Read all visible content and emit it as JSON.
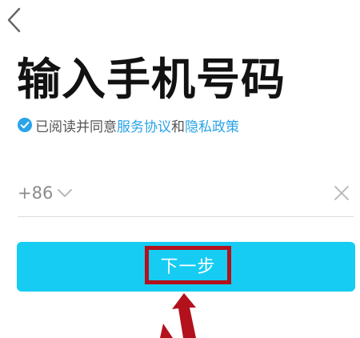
{
  "header": {
    "back_icon": "chevron-left-icon"
  },
  "title": "输入手机号码",
  "agreement": {
    "checked": true,
    "prefix": "已阅读并同意",
    "terms_link": "服务协议",
    "conjunction": "和",
    "privacy_link": "隐私政策",
    "link_color": "#2aa3e8",
    "text_color": "#555555"
  },
  "phone": {
    "country_code": "+86",
    "value": "",
    "placeholder": ""
  },
  "next_button": {
    "label": "下一步",
    "color": "#16ccf3"
  },
  "annotation": {
    "highlight_color": "#b3111c"
  }
}
